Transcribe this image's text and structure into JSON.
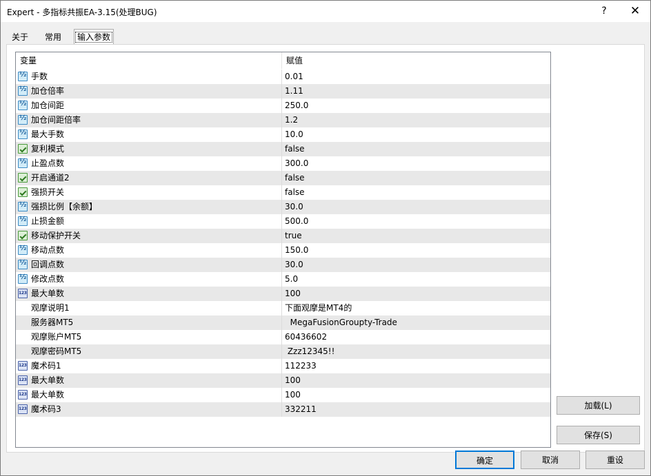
{
  "window": {
    "title": "Expert - 多指标共振EA-3.15(处理BUG)",
    "help_label": "?",
    "close_label": "✕"
  },
  "tabs": [
    {
      "label": "关于"
    },
    {
      "label": "常用"
    },
    {
      "label": "输入参数",
      "active": true
    }
  ],
  "grid": {
    "col_variable": "变量",
    "col_value": "赋值",
    "rows": [
      {
        "type": "double",
        "name": "手数",
        "value": "0.01"
      },
      {
        "type": "double",
        "name": "加仓倍率",
        "value": "1.11"
      },
      {
        "type": "double",
        "name": "加仓间距",
        "value": "250.0"
      },
      {
        "type": "double",
        "name": "加仓间距倍率",
        "value": "1.2"
      },
      {
        "type": "double",
        "name": "最大手数",
        "value": "10.0"
      },
      {
        "type": "bool",
        "name": "复利模式",
        "value": "false"
      },
      {
        "type": "double",
        "name": "止盈点数",
        "value": "300.0"
      },
      {
        "type": "bool",
        "name": "开启通道2",
        "value": "false"
      },
      {
        "type": "bool",
        "name": "强损开关",
        "value": "false"
      },
      {
        "type": "double",
        "name": "强损比例【余额】",
        "value": "30.0"
      },
      {
        "type": "double",
        "name": "止损金额",
        "value": "500.0"
      },
      {
        "type": "bool",
        "name": "移动保护开关",
        "value": "true"
      },
      {
        "type": "double",
        "name": "移动点数",
        "value": "150.0"
      },
      {
        "type": "double",
        "name": "回调点数",
        "value": "30.0"
      },
      {
        "type": "double",
        "name": "修改点数",
        "value": "5.0"
      },
      {
        "type": "int",
        "name": "最大单数",
        "value": "100"
      },
      {
        "type": "string",
        "name": "观摩说明1",
        "value": "下面观摩是MT4的"
      },
      {
        "type": "string",
        "name": "服务器MT5",
        "value": "  MegaFusionGroupty-Trade"
      },
      {
        "type": "string",
        "name": "观摩账户MT5",
        "value": "60436602"
      },
      {
        "type": "string",
        "name": "观摩密码MT5",
        "value": " Zzz12345!!"
      },
      {
        "type": "int",
        "name": "魔术码1",
        "value": "112233"
      },
      {
        "type": "int",
        "name": "最大单数",
        "value": "100"
      },
      {
        "type": "int",
        "name": "最大单数",
        "value": "100"
      },
      {
        "type": "int",
        "name": "魔术码3",
        "value": "332211"
      }
    ]
  },
  "buttons": {
    "load": "加载(L)",
    "save": "保存(S)",
    "ok": "确定",
    "cancel": "取消",
    "reset": "重设"
  }
}
